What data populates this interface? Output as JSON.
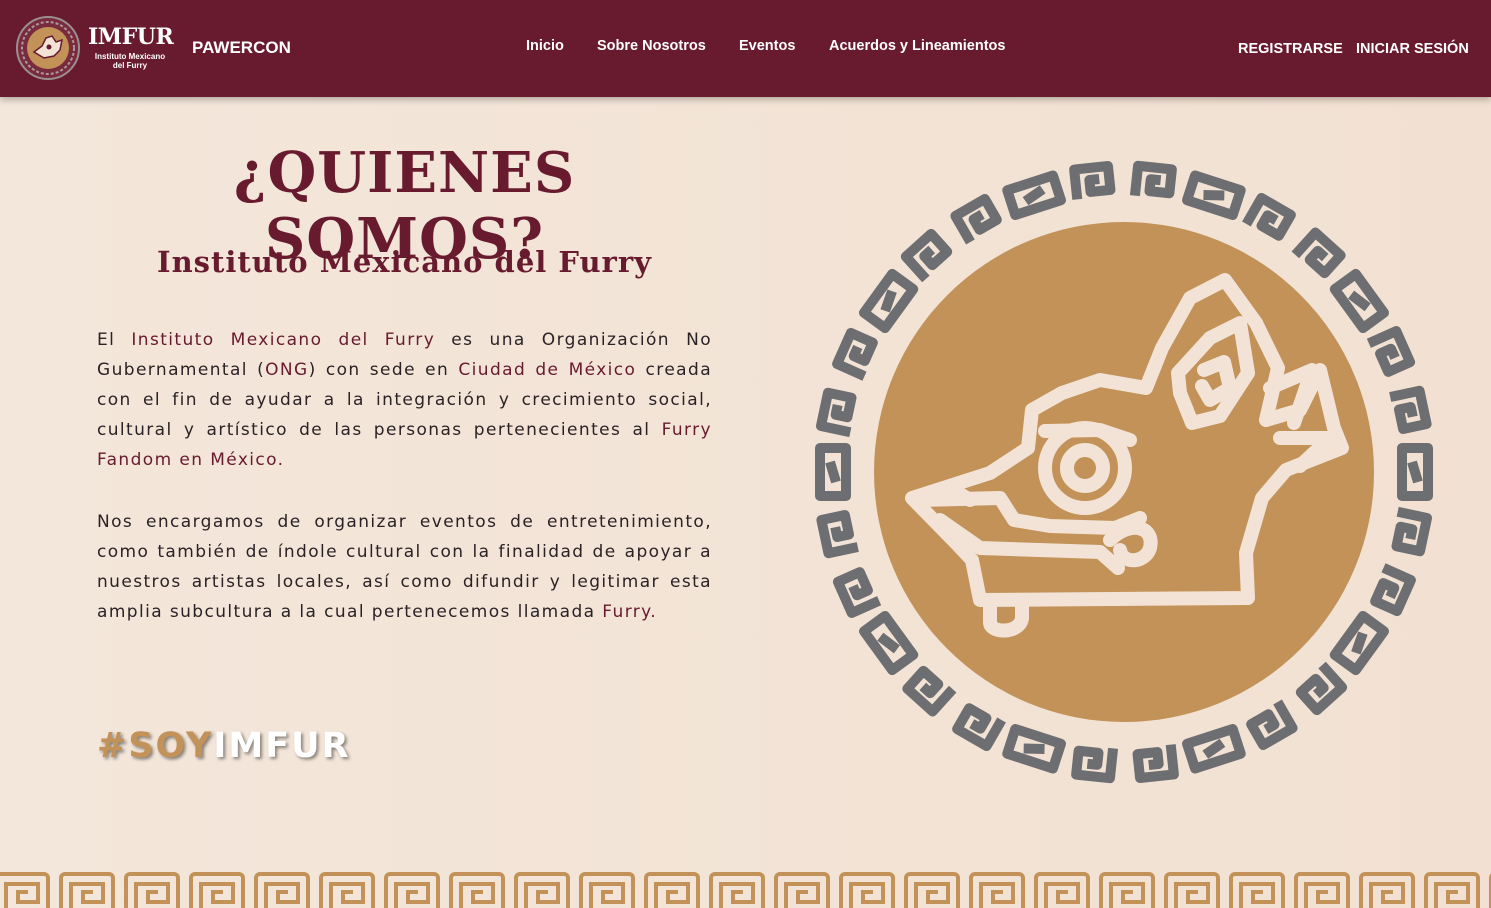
{
  "header": {
    "logo": {
      "title": "IMFUR",
      "subtitle_line1": "Instituto Mexicano",
      "subtitle_line2": "del Furry"
    },
    "brand": "PAWERCON",
    "nav": [
      {
        "label": "Inicio"
      },
      {
        "label": "Sobre Nosotros"
      },
      {
        "label": "Eventos"
      },
      {
        "label": "Acuerdos y Lineamientos"
      }
    ],
    "auth": {
      "register": "REGISTRARSE",
      "login": "INICIAR SESIÓN"
    }
  },
  "main": {
    "title": "¿QUIENES SOMOS?",
    "subtitle": "Instituto Mexicano del Furry",
    "paragraph1": {
      "t1": "El ",
      "h1": "Instituto Mexicano del Furry",
      "t2": " es una Organización No Gubernamental (",
      "h2": "ONG",
      "t3": ") con sede en ",
      "h3": "Ciudad de México",
      "t4": " creada con el fin de ayudar a la integración y crecimiento social, cultural y artístico de las personas pertenecientes al ",
      "h4": "Furry Fandom en México."
    },
    "paragraph2": {
      "t1": "Nos encargamos de organizar eventos de entretenimiento, como también de índole cultural con la finalidad de apoyar a nuestros artistas locales, así como difundir y legitimar esta amplia subcultura a la cual pertenecemos llamada ",
      "h1": "Furry."
    },
    "hashtag": {
      "part1": "#SOY",
      "part2": "IMFUR"
    }
  },
  "colors": {
    "brand_maroon": "#681a2e",
    "gold": "#c29258",
    "background": "#f2e3d6",
    "ring_gray": "#6d6e71",
    "text": "#2b2226"
  },
  "icons": {
    "logo": "imfur-coyote-emblem",
    "hero": "coyote-head-glyph-in-aztec-ring",
    "footer": "aztec-fret-border"
  }
}
